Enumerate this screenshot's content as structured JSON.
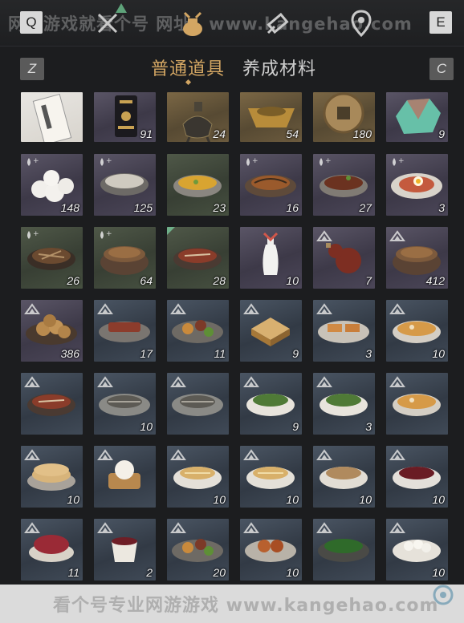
{
  "watermark_top": "网游游戏就看个号 网址：www.kangehao.com",
  "keys": {
    "q": "Q",
    "e": "E",
    "z": "Z",
    "c": "C"
  },
  "top_icons": [
    "crossed-swords-icon",
    "pouch-icon",
    "scroll-icon",
    "map-pin-icon"
  ],
  "tabs": {
    "active": "普通道具",
    "inactive": "养成材料"
  },
  "items": [
    {
      "rarity": "plain",
      "count": "",
      "art": "paper",
      "badge": ""
    },
    {
      "rarity": "purple",
      "count": "91",
      "art": "pouch",
      "badge": ""
    },
    {
      "rarity": "gold",
      "count": "24",
      "art": "incense",
      "badge": ""
    },
    {
      "rarity": "gold",
      "count": "54",
      "art": "ingot",
      "badge": ""
    },
    {
      "rarity": "gold",
      "count": "180",
      "art": "coin",
      "badge": ""
    },
    {
      "rarity": "purple",
      "count": "9",
      "art": "gem",
      "badge": ""
    },
    {
      "rarity": "purple",
      "count": "148",
      "art": "buns",
      "badge": "drop"
    },
    {
      "rarity": "purple",
      "count": "125",
      "art": "bowl-grey",
      "badge": "drop"
    },
    {
      "rarity": "green",
      "count": "23",
      "art": "bowl-yellow",
      "badge": ""
    },
    {
      "rarity": "purple",
      "count": "16",
      "art": "fish",
      "badge": "drop"
    },
    {
      "rarity": "purple",
      "count": "27",
      "art": "bowl-meat",
      "badge": "drop"
    },
    {
      "rarity": "purple",
      "count": "3",
      "art": "plate-egg",
      "badge": "drop"
    },
    {
      "rarity": "green",
      "count": "26",
      "art": "bowl-noodle",
      "badge": "drop"
    },
    {
      "rarity": "green",
      "count": "64",
      "art": "pot",
      "badge": "drop"
    },
    {
      "rarity": "green",
      "count": "28",
      "art": "bowl-red",
      "badge": ""
    },
    {
      "rarity": "purple",
      "count": "10",
      "art": "vase",
      "badge": ""
    },
    {
      "rarity": "purple",
      "count": "7",
      "art": "gourd",
      "badge": "tri"
    },
    {
      "rarity": "purple",
      "count": "412",
      "art": "pot",
      "badge": "tri"
    },
    {
      "rarity": "purple",
      "count": "386",
      "art": "pastries",
      "badge": "tri"
    },
    {
      "rarity": "blue",
      "count": "17",
      "art": "plate-meat",
      "badge": "tri"
    },
    {
      "rarity": "blue",
      "count": "11",
      "art": "plate-mixed",
      "badge": "tri"
    },
    {
      "rarity": "blue",
      "count": "9",
      "art": "cake",
      "badge": "tri"
    },
    {
      "rarity": "blue",
      "count": "3",
      "art": "plate-toast",
      "badge": "tri"
    },
    {
      "rarity": "blue",
      "count": "10",
      "art": "bowl-soup",
      "badge": "tri"
    },
    {
      "rarity": "blue",
      "count": "",
      "art": "bowl-red",
      "badge": "tri"
    },
    {
      "rarity": "blue",
      "count": "10",
      "art": "plate-fish",
      "badge": "tri"
    },
    {
      "rarity": "blue",
      "count": "",
      "art": "plate-fish",
      "badge": "tri"
    },
    {
      "rarity": "blue",
      "count": "9",
      "art": "bowl-greens",
      "badge": "tri"
    },
    {
      "rarity": "blue",
      "count": "3",
      "art": "bowl-greens",
      "badge": "tri"
    },
    {
      "rarity": "blue",
      "count": "",
      "art": "bowl-soup",
      "badge": "tri"
    },
    {
      "rarity": "blue",
      "count": "10",
      "art": "flatbread",
      "badge": "tri"
    },
    {
      "rarity": "blue",
      "count": "",
      "art": "steamer",
      "badge": "tri"
    },
    {
      "rarity": "blue",
      "count": "10",
      "art": "bowl-noodle-w",
      "badge": "tri"
    },
    {
      "rarity": "blue",
      "count": "10",
      "art": "bowl-noodle-w",
      "badge": "tri"
    },
    {
      "rarity": "blue",
      "count": "10",
      "art": "bowl-grain",
      "badge": "tri"
    },
    {
      "rarity": "blue",
      "count": "10",
      "art": "bowl-wine",
      "badge": "tri"
    },
    {
      "rarity": "blue",
      "count": "11",
      "art": "bowl-berry",
      "badge": "tri"
    },
    {
      "rarity": "blue",
      "count": "2",
      "art": "cup",
      "badge": "tri"
    },
    {
      "rarity": "blue",
      "count": "20",
      "art": "plate-mixed",
      "badge": "tri"
    },
    {
      "rarity": "blue",
      "count": "10",
      "art": "plate-meat2",
      "badge": "tri"
    },
    {
      "rarity": "blue",
      "count": "",
      "art": "plate-greens",
      "badge": "tri"
    },
    {
      "rarity": "blue",
      "count": "10",
      "art": "bowl-dumpling",
      "badge": "tri"
    }
  ],
  "banner": {
    "text": "看个号专业网游游戏 www.kangehao.com",
    "brand": "看个号"
  },
  "colors": {
    "accent": "#d3a663",
    "background": "#1c1d1f"
  }
}
